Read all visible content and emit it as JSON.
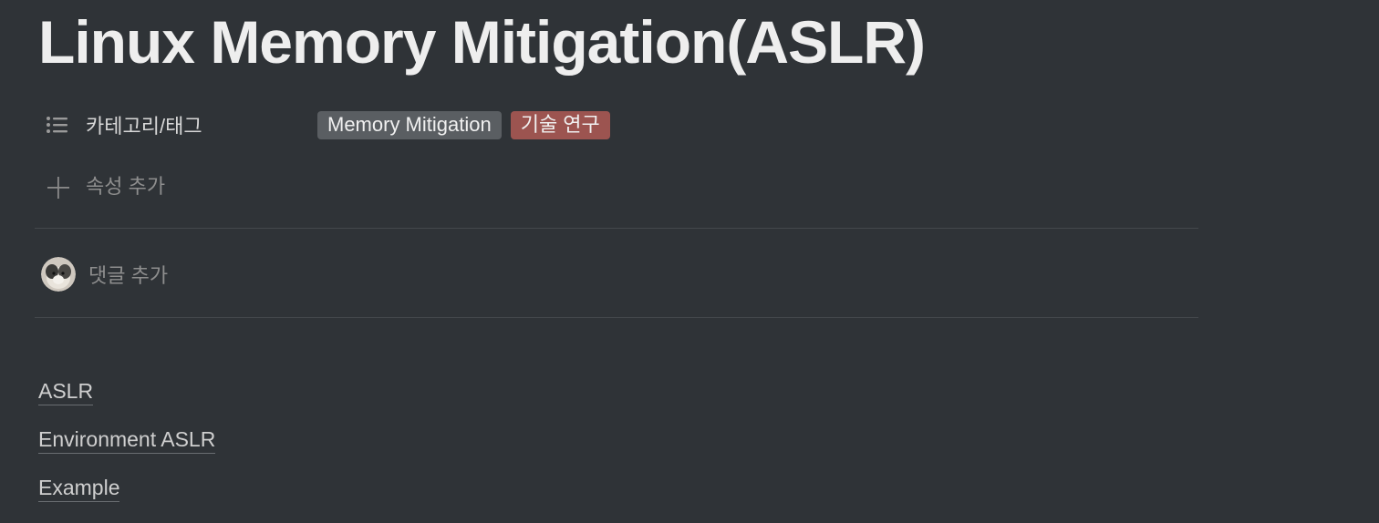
{
  "page": {
    "title": "Linux Memory Mitigation(ASLR)"
  },
  "properties": {
    "category": {
      "label": "카테고리/태그",
      "icon": "list-icon",
      "tags": [
        {
          "label": "Memory Mitigation",
          "color": "#5a5e62"
        },
        {
          "label": "기술 연구",
          "color": "#9c5450"
        }
      ]
    },
    "add_property_label": "속성 추가"
  },
  "comments": {
    "add_comment_label": "댓글 추가"
  },
  "toc": {
    "items": [
      {
        "label": "ASLR"
      },
      {
        "label": "Environment ASLR"
      },
      {
        "label": "Example"
      }
    ]
  }
}
